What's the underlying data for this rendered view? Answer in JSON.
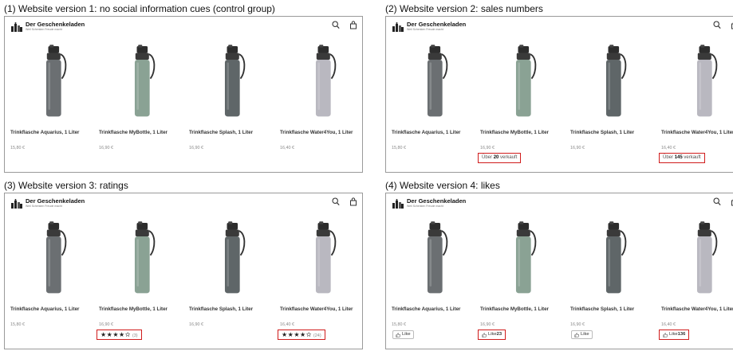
{
  "brand": {
    "name": "Der Geschenkeladen",
    "tagline": "Weil Schenken Freude macht"
  },
  "colors": {
    "highlight": "#d01c1c"
  },
  "icons": [
    "logo-icon",
    "search-icon",
    "bag-icon",
    "star-icon",
    "thumbs-up-icon"
  ],
  "products": [
    {
      "name": "Trinkflasche Aquarius, 1 Liter",
      "price": "15,80 €",
      "color": "#6b6f72"
    },
    {
      "name": "Trinkflasche MyBottle, 1 Liter",
      "price": "16,90 €",
      "color": "#8aa294"
    },
    {
      "name": "Trinkflasche Splash, 1 Liter",
      "price": "16,90 €",
      "color": "#5f6668"
    },
    {
      "name": "Trinkflasche Water4You, 1 Liter",
      "price": "16,40 €",
      "color": "#b9b8c0"
    }
  ],
  "panels": [
    {
      "caption": "(1) Website version 1: no social information cues (control group)",
      "cues": [
        null,
        null,
        null,
        null
      ]
    },
    {
      "caption": "(2) Website version 2: sales numbers",
      "cues": [
        null,
        {
          "type": "sales",
          "pre": "Über",
          "num": "20",
          "post": "verkauft"
        },
        null,
        {
          "type": "sales",
          "pre": "Über",
          "num": "145",
          "post": "verkauft"
        }
      ]
    },
    {
      "caption": "(3) Website version 3: ratings",
      "cues": [
        null,
        {
          "type": "rating",
          "stars": "★★★★✫",
          "count": "(3)"
        },
        null,
        {
          "type": "rating",
          "stars": "★★★★✫",
          "count": "(24)"
        }
      ]
    },
    {
      "caption": "(4) Website version 4: likes",
      "cues": [
        {
          "type": "like",
          "label": "Like",
          "num": "",
          "highlight": false
        },
        {
          "type": "like",
          "label": "Like",
          "num": "23",
          "highlight": true
        },
        {
          "type": "like",
          "label": "Like",
          "num": "",
          "highlight": false
        },
        {
          "type": "like",
          "label": "Like",
          "num": "136",
          "highlight": true
        }
      ]
    }
  ]
}
